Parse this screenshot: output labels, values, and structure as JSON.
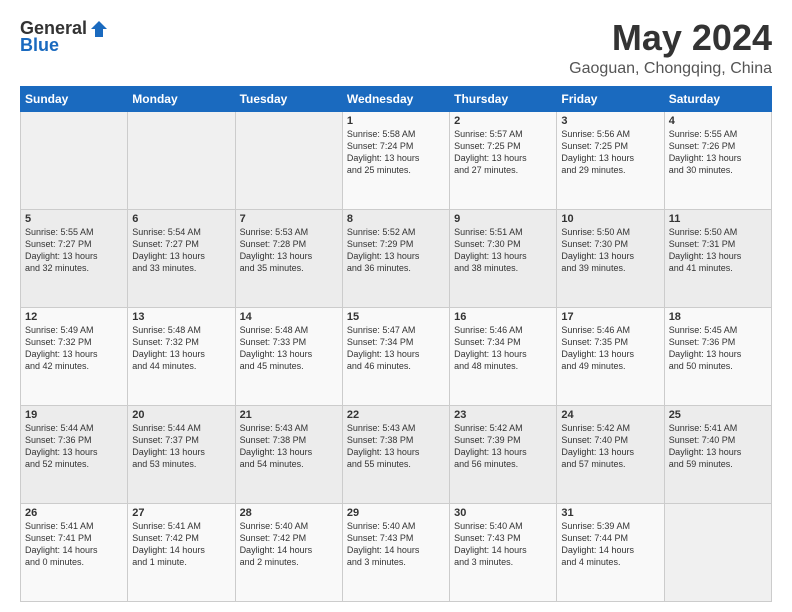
{
  "logo": {
    "general": "General",
    "blue": "Blue"
  },
  "title": "May 2024",
  "location": "Gaoguan, Chongqing, China",
  "days_of_week": [
    "Sunday",
    "Monday",
    "Tuesday",
    "Wednesday",
    "Thursday",
    "Friday",
    "Saturday"
  ],
  "weeks": [
    [
      {
        "day": "",
        "info": ""
      },
      {
        "day": "",
        "info": ""
      },
      {
        "day": "",
        "info": ""
      },
      {
        "day": "1",
        "info": "Sunrise: 5:58 AM\nSunset: 7:24 PM\nDaylight: 13 hours\nand 25 minutes."
      },
      {
        "day": "2",
        "info": "Sunrise: 5:57 AM\nSunset: 7:25 PM\nDaylight: 13 hours\nand 27 minutes."
      },
      {
        "day": "3",
        "info": "Sunrise: 5:56 AM\nSunset: 7:25 PM\nDaylight: 13 hours\nand 29 minutes."
      },
      {
        "day": "4",
        "info": "Sunrise: 5:55 AM\nSunset: 7:26 PM\nDaylight: 13 hours\nand 30 minutes."
      }
    ],
    [
      {
        "day": "5",
        "info": "Sunrise: 5:55 AM\nSunset: 7:27 PM\nDaylight: 13 hours\nand 32 minutes."
      },
      {
        "day": "6",
        "info": "Sunrise: 5:54 AM\nSunset: 7:27 PM\nDaylight: 13 hours\nand 33 minutes."
      },
      {
        "day": "7",
        "info": "Sunrise: 5:53 AM\nSunset: 7:28 PM\nDaylight: 13 hours\nand 35 minutes."
      },
      {
        "day": "8",
        "info": "Sunrise: 5:52 AM\nSunset: 7:29 PM\nDaylight: 13 hours\nand 36 minutes."
      },
      {
        "day": "9",
        "info": "Sunrise: 5:51 AM\nSunset: 7:30 PM\nDaylight: 13 hours\nand 38 minutes."
      },
      {
        "day": "10",
        "info": "Sunrise: 5:50 AM\nSunset: 7:30 PM\nDaylight: 13 hours\nand 39 minutes."
      },
      {
        "day": "11",
        "info": "Sunrise: 5:50 AM\nSunset: 7:31 PM\nDaylight: 13 hours\nand 41 minutes."
      }
    ],
    [
      {
        "day": "12",
        "info": "Sunrise: 5:49 AM\nSunset: 7:32 PM\nDaylight: 13 hours\nand 42 minutes."
      },
      {
        "day": "13",
        "info": "Sunrise: 5:48 AM\nSunset: 7:32 PM\nDaylight: 13 hours\nand 44 minutes."
      },
      {
        "day": "14",
        "info": "Sunrise: 5:48 AM\nSunset: 7:33 PM\nDaylight: 13 hours\nand 45 minutes."
      },
      {
        "day": "15",
        "info": "Sunrise: 5:47 AM\nSunset: 7:34 PM\nDaylight: 13 hours\nand 46 minutes."
      },
      {
        "day": "16",
        "info": "Sunrise: 5:46 AM\nSunset: 7:34 PM\nDaylight: 13 hours\nand 48 minutes."
      },
      {
        "day": "17",
        "info": "Sunrise: 5:46 AM\nSunset: 7:35 PM\nDaylight: 13 hours\nand 49 minutes."
      },
      {
        "day": "18",
        "info": "Sunrise: 5:45 AM\nSunset: 7:36 PM\nDaylight: 13 hours\nand 50 minutes."
      }
    ],
    [
      {
        "day": "19",
        "info": "Sunrise: 5:44 AM\nSunset: 7:36 PM\nDaylight: 13 hours\nand 52 minutes."
      },
      {
        "day": "20",
        "info": "Sunrise: 5:44 AM\nSunset: 7:37 PM\nDaylight: 13 hours\nand 53 minutes."
      },
      {
        "day": "21",
        "info": "Sunrise: 5:43 AM\nSunset: 7:38 PM\nDaylight: 13 hours\nand 54 minutes."
      },
      {
        "day": "22",
        "info": "Sunrise: 5:43 AM\nSunset: 7:38 PM\nDaylight: 13 hours\nand 55 minutes."
      },
      {
        "day": "23",
        "info": "Sunrise: 5:42 AM\nSunset: 7:39 PM\nDaylight: 13 hours\nand 56 minutes."
      },
      {
        "day": "24",
        "info": "Sunrise: 5:42 AM\nSunset: 7:40 PM\nDaylight: 13 hours\nand 57 minutes."
      },
      {
        "day": "25",
        "info": "Sunrise: 5:41 AM\nSunset: 7:40 PM\nDaylight: 13 hours\nand 59 minutes."
      }
    ],
    [
      {
        "day": "26",
        "info": "Sunrise: 5:41 AM\nSunset: 7:41 PM\nDaylight: 14 hours\nand 0 minutes."
      },
      {
        "day": "27",
        "info": "Sunrise: 5:41 AM\nSunset: 7:42 PM\nDaylight: 14 hours\nand 1 minute."
      },
      {
        "day": "28",
        "info": "Sunrise: 5:40 AM\nSunset: 7:42 PM\nDaylight: 14 hours\nand 2 minutes."
      },
      {
        "day": "29",
        "info": "Sunrise: 5:40 AM\nSunset: 7:43 PM\nDaylight: 14 hours\nand 3 minutes."
      },
      {
        "day": "30",
        "info": "Sunrise: 5:40 AM\nSunset: 7:43 PM\nDaylight: 14 hours\nand 3 minutes."
      },
      {
        "day": "31",
        "info": "Sunrise: 5:39 AM\nSunset: 7:44 PM\nDaylight: 14 hours\nand 4 minutes."
      },
      {
        "day": "",
        "info": ""
      }
    ]
  ]
}
